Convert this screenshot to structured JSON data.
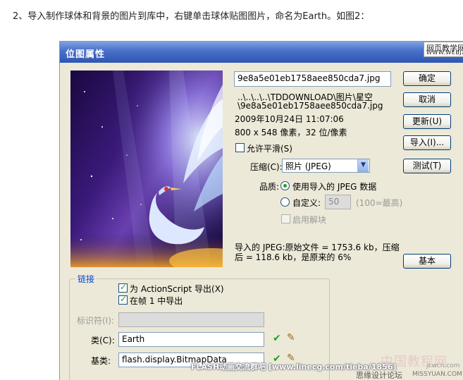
{
  "intro": "2、导入制作球体和背景的图片到库中，右键单击球体贴图图片，命名为Earth。如图2：",
  "dialog": {
    "title": "位图属性",
    "filename": "9e8a5e01eb1758aee850cda7.jpg",
    "path_line1": "..\\..\\..\\..\\TDDOWNLOAD\\图片\\星空",
    "path_line2": "\\9e8a5e01eb1758aee850cda7.jpg",
    "date": "2009年10月24日  11:07:06",
    "dimensions": "800 x 548 像素，32 位/像素",
    "smoothing_label": "允许平滑(S)",
    "smoothing_checked": false,
    "compression_label": "压缩(C):",
    "compression_value": "照片 (JPEG)",
    "quality_label": "品质:",
    "use_imported_label": "使用导入的 JPEG 数据",
    "custom_label": "自定义:",
    "custom_value": "50",
    "custom_hint": "(100=最高)",
    "deblocking_label": "启用解块",
    "jpeg_info_line1": "导入的 JPEG:原始文件 = 1753.6 kb，压缩",
    "jpeg_info_line2": "后 = 118.6 kb，是原来的 6%",
    "buttons": {
      "ok": "确定",
      "cancel": "取消",
      "update": "更新(U)",
      "import": "导入(I)...",
      "test": "测试(T)",
      "basic": "基本"
    },
    "linkage": {
      "title": "链接",
      "export_as_label": "为 ActionScript 导出(X)",
      "export_as_checked": true,
      "export_frame_label": "在帧 1 中导出",
      "export_frame_checked": true,
      "identifier_label": "标识符(I):",
      "identifier_value": "",
      "class_label": "类(C):",
      "class_value": "Earth",
      "base_class_label": "基类:",
      "base_class_value": "flash.display.BitmapData"
    }
  },
  "watermarks": {
    "top_line1": "网页教学网",
    "top_line2": "WWW.WEBJX.COM",
    "footer": "FLASH动画交流群吧  [www.linecg.com/tieba/1856]",
    "corner_big": "中国教程网",
    "corner_small1": "思缘设计论坛",
    "corner_small2": "MISSYUAN.COM",
    "corner_small3": "jcwcn.com"
  },
  "colors": {
    "dialog_bg": "#ece9d8",
    "title_bar": "#2d56b3",
    "check_green": "#21a121",
    "group_title": "#0046d5"
  }
}
